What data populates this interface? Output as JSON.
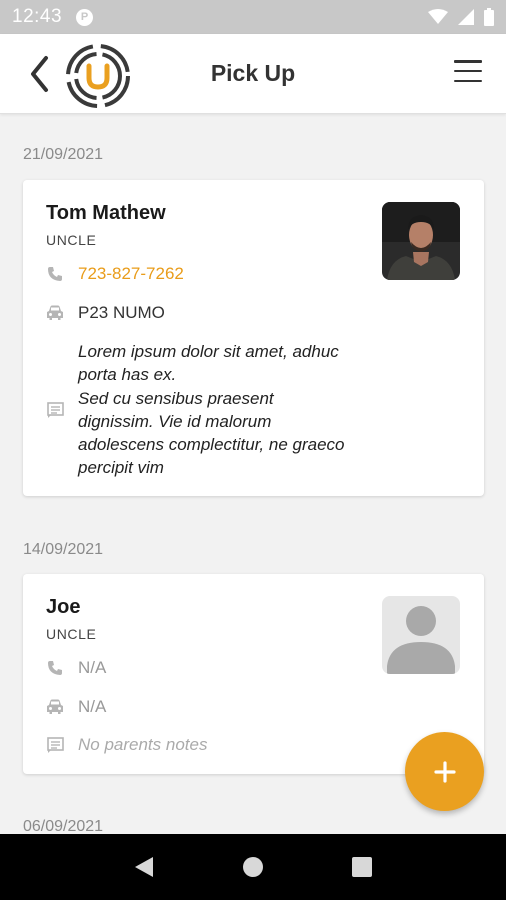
{
  "status_bar": {
    "time": "12:43",
    "app_badge": "P"
  },
  "header": {
    "title": "Pick Up"
  },
  "colors": {
    "accent": "#eaa020",
    "phone": "#e99c1a",
    "logo_dark": "#3a3a3a"
  },
  "pickups": [
    {
      "date": "21/09/2021",
      "name": "Tom Mathew",
      "relation": "UNCLE",
      "phone": "723-827-7262",
      "vehicle": "P23 NUMO",
      "notes": "Lorem ipsum dolor sit amet, adhuc\nporta has ex.\nSed cu sensibus praesent\ndignissim. Vie id malorum\nadolescens complectitur, ne graeco\npercipit vim",
      "avatar": "photo"
    },
    {
      "date": "14/09/2021",
      "name": "Joe",
      "relation": "UNCLE",
      "phone": "N/A",
      "vehicle": "N/A",
      "notes_placeholder": "No parents notes",
      "avatar": "placeholder"
    },
    {
      "date": "06/09/2021"
    }
  ]
}
